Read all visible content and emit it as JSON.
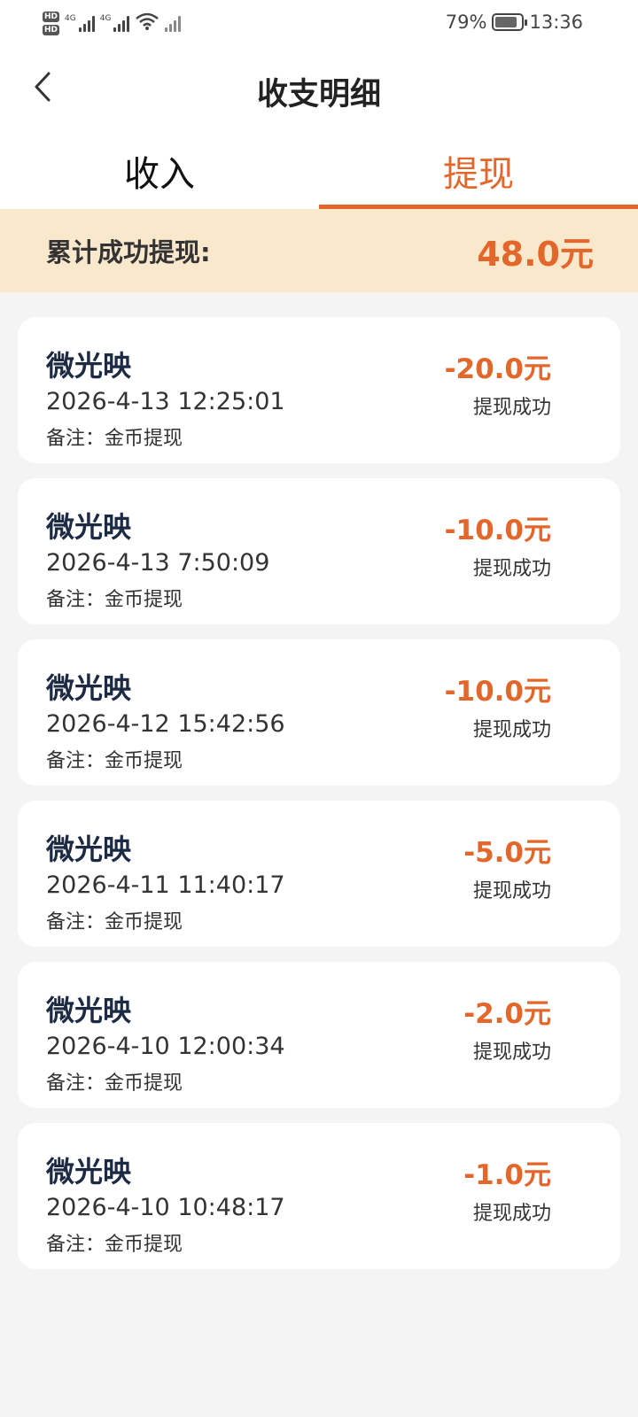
{
  "status_bar": {
    "hd1": "HD",
    "hd2": "HD",
    "net1": "4G",
    "net2": "4G",
    "battery_percent": "79%",
    "time": "13:36"
  },
  "header": {
    "title": "收支明细"
  },
  "tabs": [
    {
      "label": "收入",
      "active": false
    },
    {
      "label": "提现",
      "active": true
    }
  ],
  "summary": {
    "label": "累计成功提现:",
    "value": "48.0元"
  },
  "records": [
    {
      "name": "微光映",
      "time": "2026-4-13 12:25:01",
      "note": "备注：金币提现",
      "amount": "-20.0元",
      "status": "提现成功"
    },
    {
      "name": "微光映",
      "time": "2026-4-13 7:50:09",
      "note": "备注：金币提现",
      "amount": "-10.0元",
      "status": "提现成功"
    },
    {
      "name": "微光映",
      "time": "2026-4-12 15:42:56",
      "note": "备注：金币提现",
      "amount": "-10.0元",
      "status": "提现成功"
    },
    {
      "name": "微光映",
      "time": "2026-4-11 11:40:17",
      "note": "备注：金币提现",
      "amount": "-5.0元",
      "status": "提现成功"
    },
    {
      "name": "微光映",
      "time": "2026-4-10 12:00:34",
      "note": "备注：金币提现",
      "amount": "-2.0元",
      "status": "提现成功"
    },
    {
      "name": "微光映",
      "time": "2026-4-10 10:48:17",
      "note": "备注：金币提现",
      "amount": "-1.0元",
      "status": "提现成功"
    }
  ],
  "colors": {
    "accent": "#e3672b",
    "banner": "#f9e8cc",
    "name_text": "#1c2a44",
    "background": "#f4f4f4"
  },
  "icons": {
    "back": "chevron-left-icon",
    "wifi": "wifi-icon",
    "battery": "battery-icon"
  }
}
